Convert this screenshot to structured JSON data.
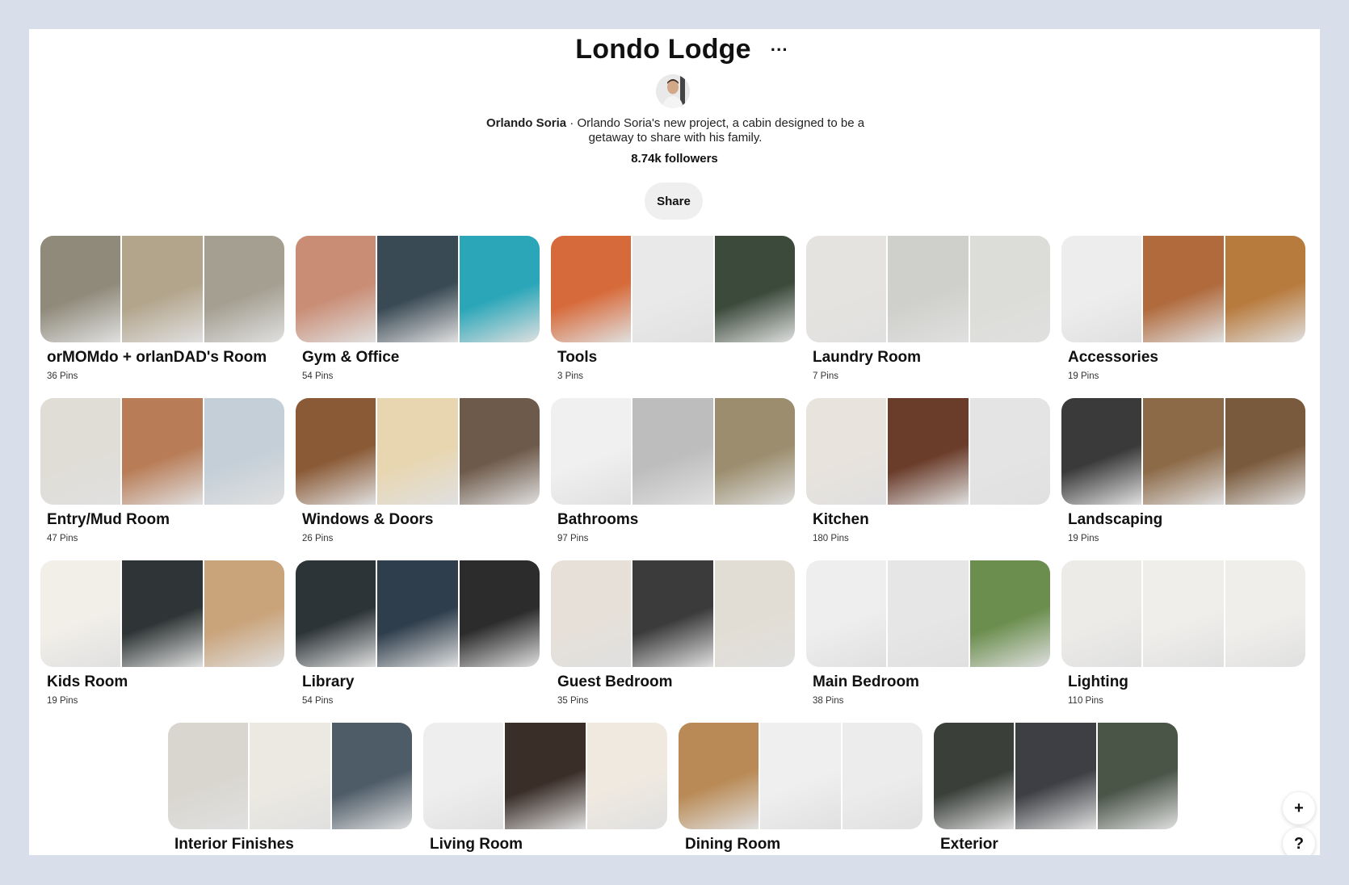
{
  "board": {
    "title": "Londo Lodge",
    "more_icon": "more-horizontal-icon",
    "owner_name": "Orlando Soria",
    "description": "· Orlando Soria's new project, a cabin designed to be a getaway to share with his family.",
    "followers": "8.74k followers",
    "share_label": "Share"
  },
  "sections": [
    {
      "name": "orMOMdo + orlanDAD's Room",
      "pins": "36 Pins",
      "tiles": [
        "#8f8a7a",
        "#b3a58c",
        "#a49f91"
      ]
    },
    {
      "name": "Gym & Office",
      "pins": "54 Pins",
      "tiles": [
        "#c98c74",
        "#3a4a55",
        "#2aa6b8"
      ]
    },
    {
      "name": "Tools",
      "pins": "3 Pins",
      "tiles": [
        "#d76a3a",
        "#e9e9e9",
        "#3b4a3b"
      ]
    },
    {
      "name": "Laundry Room",
      "pins": "7 Pins",
      "tiles": [
        "#e5e3df",
        "#cfcfcb",
        "#dcdcd8"
      ]
    },
    {
      "name": "Accessories",
      "pins": "19 Pins",
      "tiles": [
        "#ededed",
        "#b06a3c",
        "#b87b3e"
      ]
    },
    {
      "name": "Entry/Mud Room",
      "pins": "47 Pins",
      "tiles": [
        "#e0ddd6",
        "#b87c56",
        "#c4cfd8"
      ]
    },
    {
      "name": "Windows & Doors",
      "pins": "26 Pins",
      "tiles": [
        "#8a5a36",
        "#e8d6b0",
        "#6e5a4a"
      ]
    },
    {
      "name": "Bathrooms",
      "pins": "97 Pins",
      "tiles": [
        "#f0f0f0",
        "#bdbdbd",
        "#9b8d6d"
      ]
    },
    {
      "name": "Kitchen",
      "pins": "180 Pins",
      "tiles": [
        "#e8e3dc",
        "#6a3c2a",
        "#e4e4e4"
      ]
    },
    {
      "name": "Landscaping",
      "pins": "19 Pins",
      "tiles": [
        "#3a3a3a",
        "#8c6a48",
        "#7a5a3c"
      ]
    },
    {
      "name": "Kids Room",
      "pins": "19 Pins",
      "tiles": [
        "#f2efe9",
        "#2f3536",
        "#c9a37a"
      ]
    },
    {
      "name": "Library",
      "pins": "54 Pins",
      "tiles": [
        "#2c3438",
        "#2f3e4c",
        "#2c2c2c"
      ]
    },
    {
      "name": "Guest Bedroom",
      "pins": "35 Pins",
      "tiles": [
        "#e6e0d8",
        "#3b3b3b",
        "#e2ddd4"
      ]
    },
    {
      "name": "Main Bedroom",
      "pins": "38 Pins",
      "tiles": [
        "#eeeeee",
        "#e6e6e6",
        "#6b8e4e"
      ]
    },
    {
      "name": "Lighting",
      "pins": "110 Pins",
      "tiles": [
        "#ecebe8",
        "#efeeeb",
        "#efeeeb"
      ]
    },
    {
      "name": "Interior Finishes",
      "pins": "",
      "tiles": [
        "#d9d6cf",
        "#ece9e2",
        "#4e5c68"
      ]
    },
    {
      "name": "Living Room",
      "pins": "",
      "tiles": [
        "#eeeeee",
        "#3a2e28",
        "#efe9e0"
      ]
    },
    {
      "name": "Dining Room",
      "pins": "",
      "tiles": [
        "#b98a55",
        "#efefef",
        "#ececec"
      ]
    },
    {
      "name": "Exterior",
      "pins": "",
      "tiles": [
        "#3a3f3a",
        "#3d3f44",
        "#4a5548"
      ]
    }
  ],
  "floating": {
    "add_label": "+",
    "add_icon": "plus-icon",
    "help_label": "?",
    "help_icon": "help-icon"
  }
}
